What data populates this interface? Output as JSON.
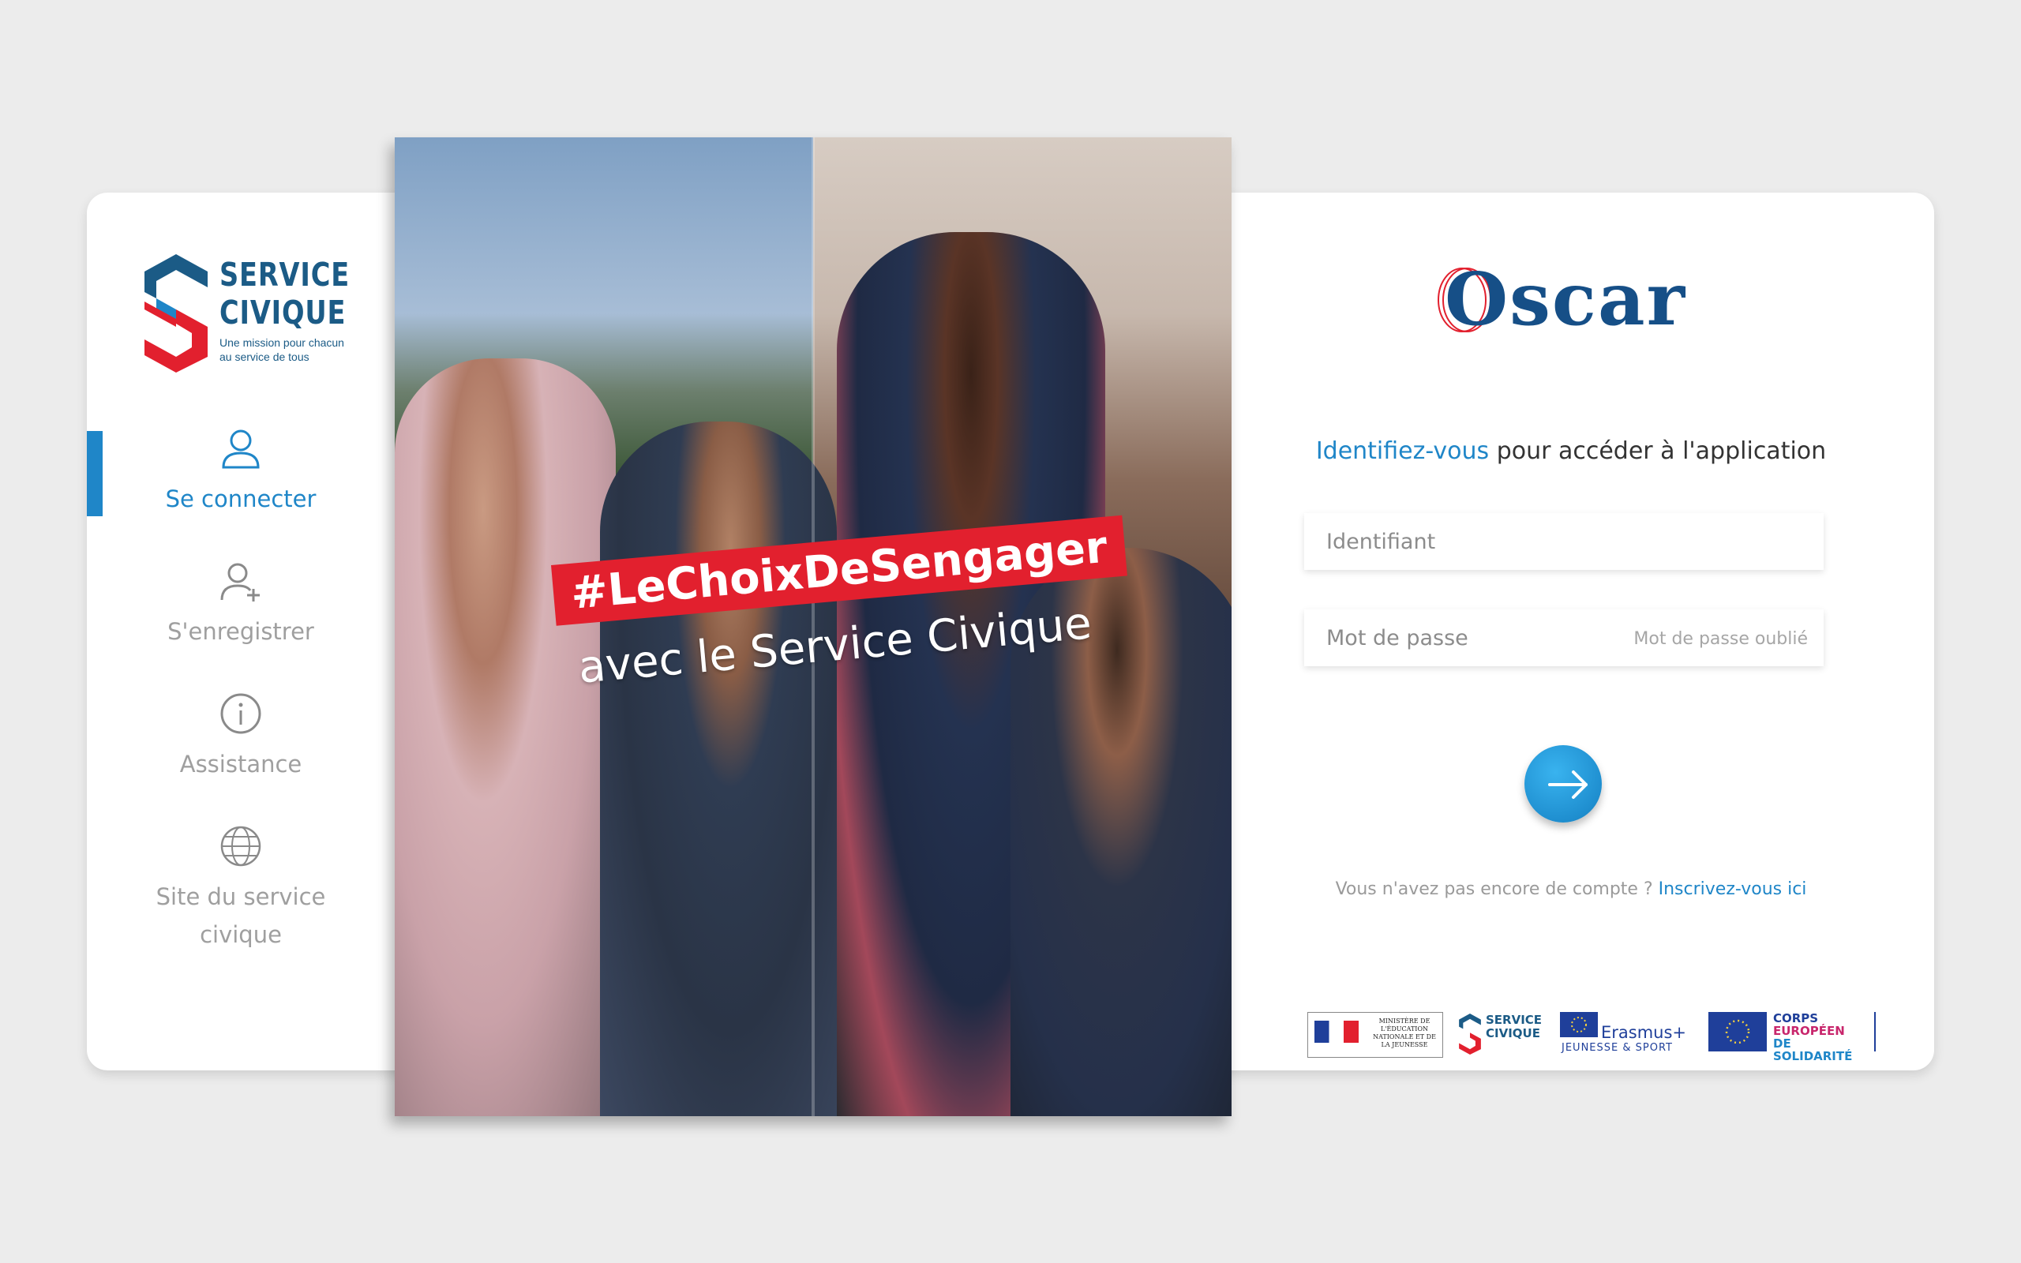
{
  "brand": {
    "title_line1": "SERVICE",
    "title_line2": "CIVIQUE",
    "tagline": "Une mission pour chacun au service de tous"
  },
  "sidebar": {
    "items": [
      {
        "label": "Se connecter",
        "icon": "user-icon",
        "active": true
      },
      {
        "label": "S'enregistrer",
        "icon": "user-plus-icon",
        "active": false
      },
      {
        "label": "Assistance",
        "icon": "info-icon",
        "active": false
      },
      {
        "label": "Site du service civique",
        "icon": "globe-icon",
        "active": false
      }
    ]
  },
  "hero": {
    "hashtag": "#LeChoixDeSengager",
    "tagline": "avec le Service Civique"
  },
  "login": {
    "app_name": "Oscar",
    "subtitle_accent": "Identifiez-vous",
    "subtitle_rest": " pour accéder à l'application",
    "username_placeholder": "Identifiant",
    "password_placeholder": "Mot de passe",
    "forgot_label": "Mot de passe oublié",
    "submit_icon": "arrow-right-icon",
    "no_account_text": "Vous n'avez pas encore de compte ? ",
    "register_link": "Inscrivez-vous ici"
  },
  "partners": {
    "ministry": "MINISTÈRE DE L'ÉDUCATION NATIONALE ET DE LA JEUNESSE",
    "service_civique": "SERVICE CIVIQUE",
    "erasmus": "Erasmus+",
    "erasmus_sub": "JEUNESSE & SPORT",
    "esc_line1": "CORPS",
    "esc_line2": "EUROPÉEN",
    "esc_line3": "DE SOLIDARITÉ"
  },
  "colors": {
    "accent": "#1f86c8",
    "brand_blue": "#1b5b86",
    "brand_red": "#e2202e",
    "background": "#ececec"
  }
}
